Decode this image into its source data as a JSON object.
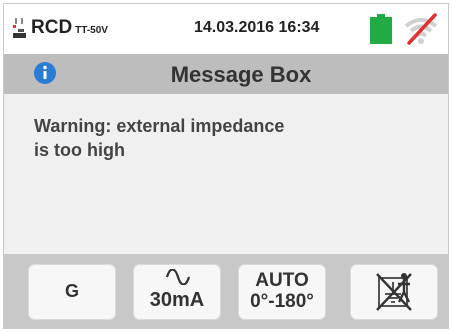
{
  "status": {
    "mode": "RCD",
    "mode_sub": "TT-50V",
    "datetime": "14.03.2016 16:34",
    "battery_color": "#22aa44",
    "icons": [
      "rcd-plug-icon",
      "battery-icon",
      "wifi-off-icon"
    ]
  },
  "dialog": {
    "title": "Message Box",
    "icon": "info-icon",
    "message_line1": "Warning: external impedance",
    "message_line2": "is too high"
  },
  "bottom": {
    "btn_g": "G",
    "btn_current": "30mA",
    "btn_current_icon": "ac-wave-icon",
    "btn_auto_line1": "AUTO",
    "btn_auto_line2": "0°-180°",
    "btn_earth_icon": "no-earth-icon"
  },
  "colors": {
    "titlebar": "#bdbdbd",
    "bottombar": "#c8c8c8",
    "info": "#2a7bd6",
    "wifi_off_slash": "#e03030"
  }
}
